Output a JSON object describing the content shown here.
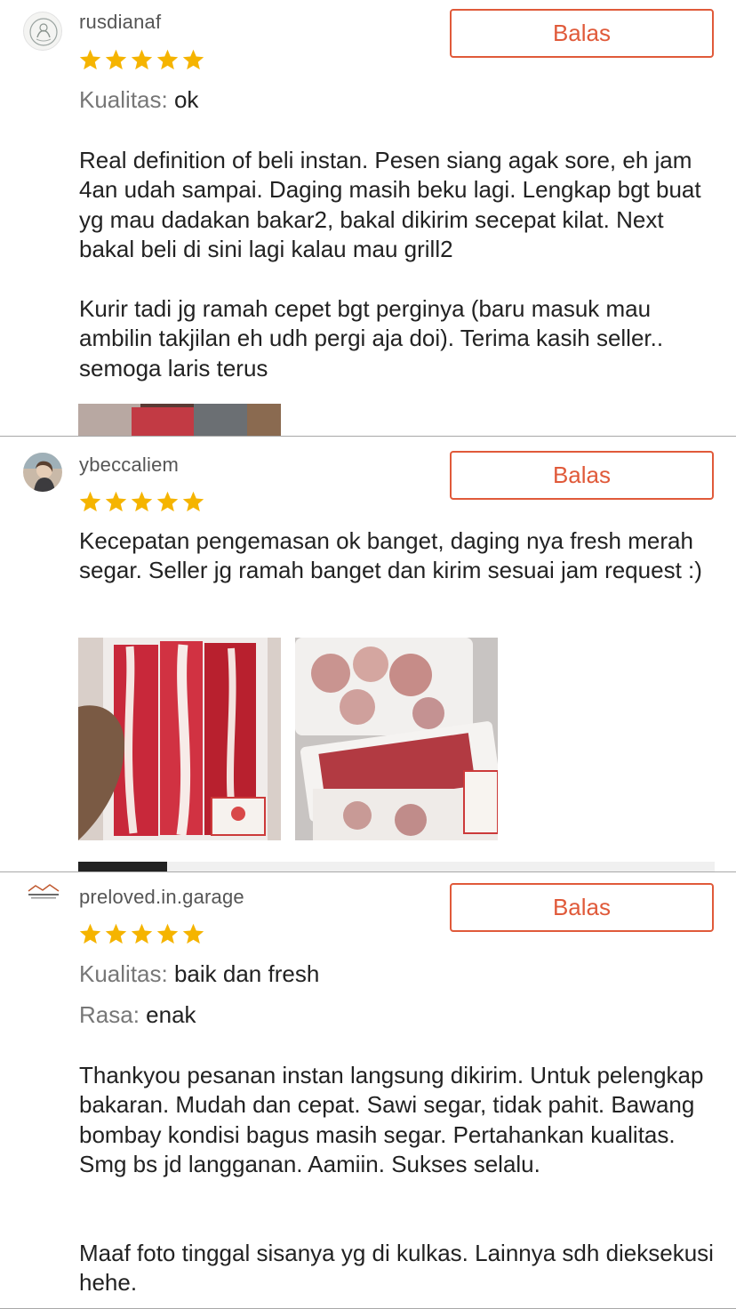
{
  "reply_label": "Balas",
  "colors": {
    "accent": "#e05a3a",
    "star": "#f5b400",
    "divider": "#a8a8a8"
  },
  "reviews": [
    {
      "username": "rusdianaf",
      "rating": 5,
      "attributes": [
        {
          "label": "Kualitas:",
          "value": "ok"
        }
      ],
      "paragraphs": [
        "Real definition of beli instan. Pesen siang agak sore, eh jam 4an udah sampai. Daging masih beku lagi. Lengkap bgt buat yg mau dadakan bakar2, bakal dikirim secepat kilat. Next bakal beli di sini lagi kalau mau grill2",
        "Kurir tadi jg ramah cepet bgt perginya (baru masuk mau ambilin takjilan eh udh pergi aja doi). Terima kasih seller.. semoga laris terus"
      ]
    },
    {
      "username": "ybeccaliem",
      "rating": 5,
      "attributes": [],
      "paragraphs": [
        "Kecepatan pengemasan ok banget, daging nya fresh merah segar. Seller jg ramah banget dan kirim sesuai jam request :)"
      ]
    },
    {
      "username": "preloved.in.garage",
      "rating": 5,
      "attributes": [
        {
          "label": "Kualitas:",
          "value": "baik dan fresh"
        },
        {
          "label": "Rasa:",
          "value": "enak"
        }
      ],
      "paragraphs": [
        "Thankyou pesanan instan langsung dikirim. Untuk pelengkap bakaran. Mudah dan cepat. Sawi segar, tidak pahit. Bawang bombay kondisi bagus masih segar. Pertahankan kualitas. Smg bs jd langganan. Aamiin. Sukses selalu.",
        "Maaf foto tinggal sisanya yg di kulkas. Lainnya sdh dieksekusi hehe."
      ]
    }
  ]
}
